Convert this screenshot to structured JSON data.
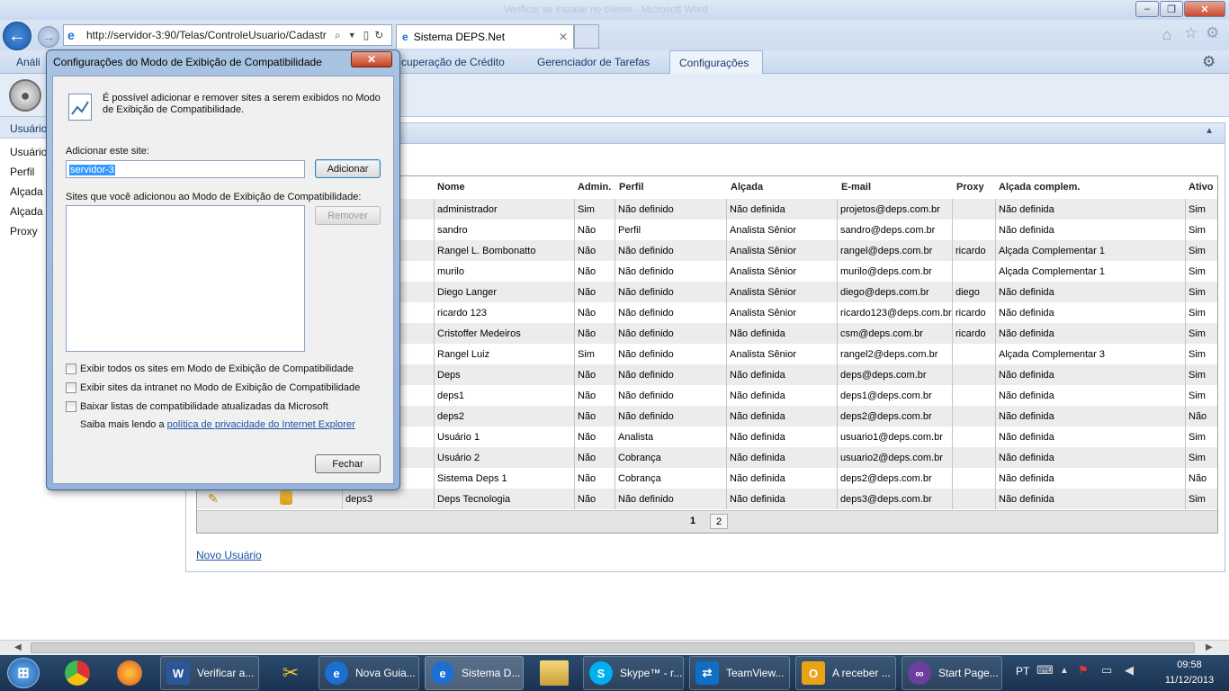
{
  "window": {
    "title": "Verificar se instalar no cliente - Microsoft Word",
    "controls": [
      "–",
      "❐",
      "✕"
    ]
  },
  "browser": {
    "address": "http://servidor-3:90/Telas/ControleUsuario/Cadastr",
    "tab_title": "Sistema DEPS.Net"
  },
  "menu": {
    "items": [
      "Análi",
      "cuperação de Crédito",
      "Gerenciador de Tarefas",
      "Configurações"
    ]
  },
  "left_nav": {
    "header": "Usuário",
    "items": [
      "Usuário",
      "Perfil",
      "Alçada",
      "Alçada",
      "Proxy"
    ]
  },
  "grid": {
    "headers": [
      "Nome",
      "Admin.",
      "Perfil",
      "Alçada",
      "E-mail",
      "Proxy",
      "Alçada complem.",
      "Ativo"
    ],
    "rows": [
      {
        "login": "r",
        "nome": "administrador",
        "admin": "Sim",
        "perfil": "Não definido",
        "alcada": "Não definida",
        "email": "projetos@deps.com.br",
        "proxy": "",
        "complem": "Não definida",
        "ativo": "Sim"
      },
      {
        "login": "",
        "nome": "sandro",
        "admin": "Não",
        "perfil": "Perfil",
        "alcada": "Analista Sênior",
        "email": "sandro@deps.com.br",
        "proxy": "",
        "complem": "Não definida",
        "ativo": "Sim"
      },
      {
        "login": "",
        "nome": "Rangel L. Bombonatto",
        "admin": "Não",
        "perfil": "Não definido",
        "alcada": "Analista Sênior",
        "email": "rangel@deps.com.br",
        "proxy": "ricardo",
        "complem": "Alçada Complementar 1",
        "ativo": "Sim"
      },
      {
        "login": "",
        "nome": "murilo",
        "admin": "Não",
        "perfil": "Não definido",
        "alcada": "Analista Sênior",
        "email": "murilo@deps.com.br",
        "proxy": "",
        "complem": "Alçada Complementar 1",
        "ativo": "Sim"
      },
      {
        "login": "",
        "nome": "Diego Langer",
        "admin": "Não",
        "perfil": "Não definido",
        "alcada": "Analista Sênior",
        "email": "diego@deps.com.br",
        "proxy": "diego",
        "complem": "Não definida",
        "ativo": "Sim"
      },
      {
        "login": "",
        "nome": "ricardo 123",
        "admin": "Não",
        "perfil": "Não definido",
        "alcada": "Analista Sênior",
        "email": "ricardo123@deps.com.br",
        "proxy": "ricardo",
        "complem": "Não definida",
        "ativo": "Sim"
      },
      {
        "login": "",
        "nome": "Cristoffer Medeiros",
        "admin": "Não",
        "perfil": "Não definido",
        "alcada": "Não definida",
        "email": "csm@deps.com.br",
        "proxy": "ricardo",
        "complem": "Não definida",
        "ativo": "Sim"
      },
      {
        "login": "",
        "nome": "Rangel Luiz",
        "admin": "Sim",
        "perfil": "Não definido",
        "alcada": "Analista Sênior",
        "email": "rangel2@deps.com.br",
        "proxy": "",
        "complem": "Alçada Complementar 3",
        "ativo": "Sim"
      },
      {
        "login": "",
        "nome": "Deps",
        "admin": "Não",
        "perfil": "Não definido",
        "alcada": "Não definida",
        "email": "deps@deps.com.br",
        "proxy": "",
        "complem": "Não definida",
        "ativo": "Sim"
      },
      {
        "login": "",
        "nome": "deps1",
        "admin": "Não",
        "perfil": "Não definido",
        "alcada": "Não definida",
        "email": "deps1@deps.com.br",
        "proxy": "",
        "complem": "Não definida",
        "ativo": "Sim"
      },
      {
        "login": "",
        "nome": "deps2",
        "admin": "Não",
        "perfil": "Não definido",
        "alcada": "Não definida",
        "email": "deps2@deps.com.br",
        "proxy": "",
        "complem": "Não definida",
        "ativo": "Não"
      },
      {
        "login": "",
        "nome": "Usuário 1",
        "admin": "Não",
        "perfil": "Analista",
        "alcada": "Não definida",
        "email": "usuario1@deps.com.br",
        "proxy": "",
        "complem": "Não definida",
        "ativo": "Sim"
      },
      {
        "login": "",
        "nome": "Usuário 2",
        "admin": "Não",
        "perfil": "Cobrança",
        "alcada": "Não definida",
        "email": "usuario2@deps.com.br",
        "proxy": "",
        "complem": "Não definida",
        "ativo": "Sim"
      },
      {
        "login": "",
        "nome": "Sistema Deps 1",
        "admin": "Não",
        "perfil": "Cobrança",
        "alcada": "Não definida",
        "email": "deps2@deps.com.br",
        "proxy": "",
        "complem": "Não definida",
        "ativo": "Não"
      },
      {
        "login": "deps3",
        "nome": "Deps Tecnologia",
        "admin": "Não",
        "perfil": "Não definido",
        "alcada": "Não definida",
        "email": "deps3@deps.com.br",
        "proxy": "",
        "complem": "Não definida",
        "ativo": "Sim"
      }
    ],
    "pages": [
      "1",
      "2"
    ]
  },
  "novo_usuario": "Novo Usuário",
  "dialog": {
    "title": "Configurações do Modo de Exibição de Compatibilidade",
    "close": "✕",
    "intro": "É possível adicionar e remover sites a serem exibidos no Modo de Exibição de Compatibilidade.",
    "add_label": "Adicionar este site:",
    "add_value": "servidor-3",
    "add_button": "Adicionar",
    "list_label": "Sites que você adicionou ao Modo de Exibição de Compatibilidade:",
    "remove_button": "Remover",
    "options": [
      {
        "label": "Exibir todos os sites em Modo de Exibição de Compatibilidade",
        "checked": false
      },
      {
        "label": "Exibir sites da intranet no Modo de Exibição de Compatibilidade",
        "checked": false
      },
      {
        "label": "Baixar listas de compatibilidade atualizadas da Microsoft",
        "checked": false
      }
    ],
    "learn_prefix": "Saiba mais lendo a ",
    "learn_link": "política de privacidade do Internet Explorer",
    "close_button": "Fechar"
  },
  "taskbar": {
    "buttons": [
      "Verificar a...",
      "Nova Guia...",
      "Sistema D...",
      "Skype™ - r...",
      "TeamView...",
      "A receber ...",
      "Start Page..."
    ],
    "lang": "PT",
    "time": "09:58",
    "date": "11/12/2013"
  },
  "colors": {
    "accent": "#1a52a6",
    "title_blue": "#dfe9f5",
    "taskbar": "#1f3a5c"
  }
}
